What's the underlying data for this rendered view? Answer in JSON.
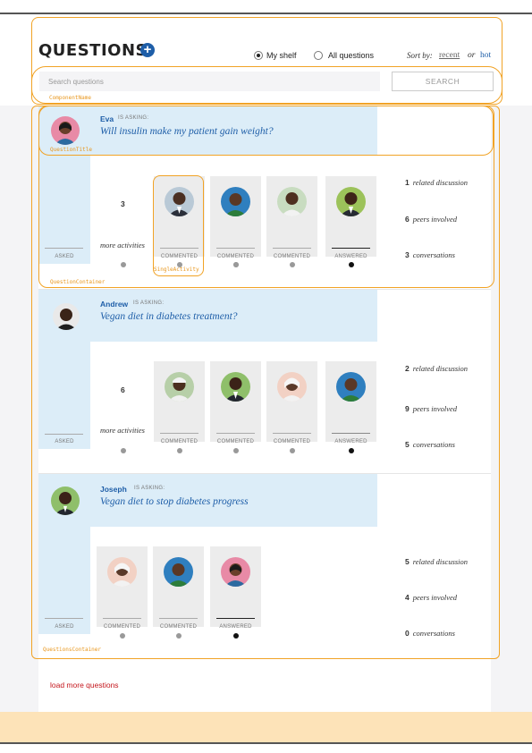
{
  "header": {
    "title": "QUESTIONS",
    "add_icon": "plus-icon",
    "filters": [
      {
        "label": "My shelf",
        "selected": true
      },
      {
        "label": "All questions",
        "selected": false
      }
    ],
    "sort_label": "Sort by:",
    "sort_recent": "recent",
    "sort_or": "or",
    "sort_hot": "hot"
  },
  "search": {
    "placeholder": "Search questions",
    "button": "SEARCH"
  },
  "annotations": {
    "component_name": "ComponentName",
    "question_title": "QuestionTitle",
    "single_activity": "SingleActivity",
    "question_container": "QuestionContainer",
    "questions_container": "QuestionsContainer"
  },
  "questions": [
    {
      "asker": "Eva",
      "asking_label": "IS ASKING:",
      "title": "Will insulin make my patient gain weight?",
      "asked_label": "ASKED",
      "more_count": "3",
      "more_label": "more activities",
      "activities": [
        {
          "label": "COMMENTED",
          "state": "commented"
        },
        {
          "label": "COMMENTED",
          "state": "commented"
        },
        {
          "label": "COMMENTED",
          "state": "commented"
        },
        {
          "label": "ANSWERED",
          "state": "answered"
        }
      ],
      "stats": [
        {
          "count": "1",
          "label": "related discussion"
        },
        {
          "count": "6",
          "label": "peers involved"
        },
        {
          "count": "3",
          "label": "conversations"
        }
      ]
    },
    {
      "asker": "Andrew",
      "asking_label": "IS ASKING:",
      "title": "Vegan diet in diabetes treatment?",
      "asked_label": "ASKED",
      "more_count": "6",
      "more_label": "more activities",
      "activities": [
        {
          "label": "COMMENTED",
          "state": "commented"
        },
        {
          "label": "COMMENTED",
          "state": "commented"
        },
        {
          "label": "COMMENTED",
          "state": "commented"
        },
        {
          "label": "ANSWERED",
          "state": "answered"
        }
      ],
      "stats": [
        {
          "count": "2",
          "label": "related discussion"
        },
        {
          "count": "9",
          "label": "peers involved"
        },
        {
          "count": "5",
          "label": "conversations"
        }
      ]
    },
    {
      "asker": "Joseph",
      "asking_label": "IS ASKING:",
      "title": "Vegan diet to stop diabetes progress",
      "asked_label": "ASKED",
      "activities": [
        {
          "label": "COMMENTED",
          "state": "commented"
        },
        {
          "label": "COMMENTED",
          "state": "commented"
        },
        {
          "label": "ANSWERED",
          "state": "answered"
        }
      ],
      "stats": [
        {
          "count": "5",
          "label": "related discussion"
        },
        {
          "count": "4",
          "label": "peers involved"
        },
        {
          "count": "0",
          "label": "conversations"
        }
      ]
    }
  ],
  "footer": {
    "load_more": "load more questions"
  },
  "colors": {
    "accent": "#1e5ea8",
    "question_band": "#dcedf8",
    "annotation_outline": "#f1a326",
    "load_more": "#c4161c",
    "bottom_band": "#fde3b8"
  }
}
